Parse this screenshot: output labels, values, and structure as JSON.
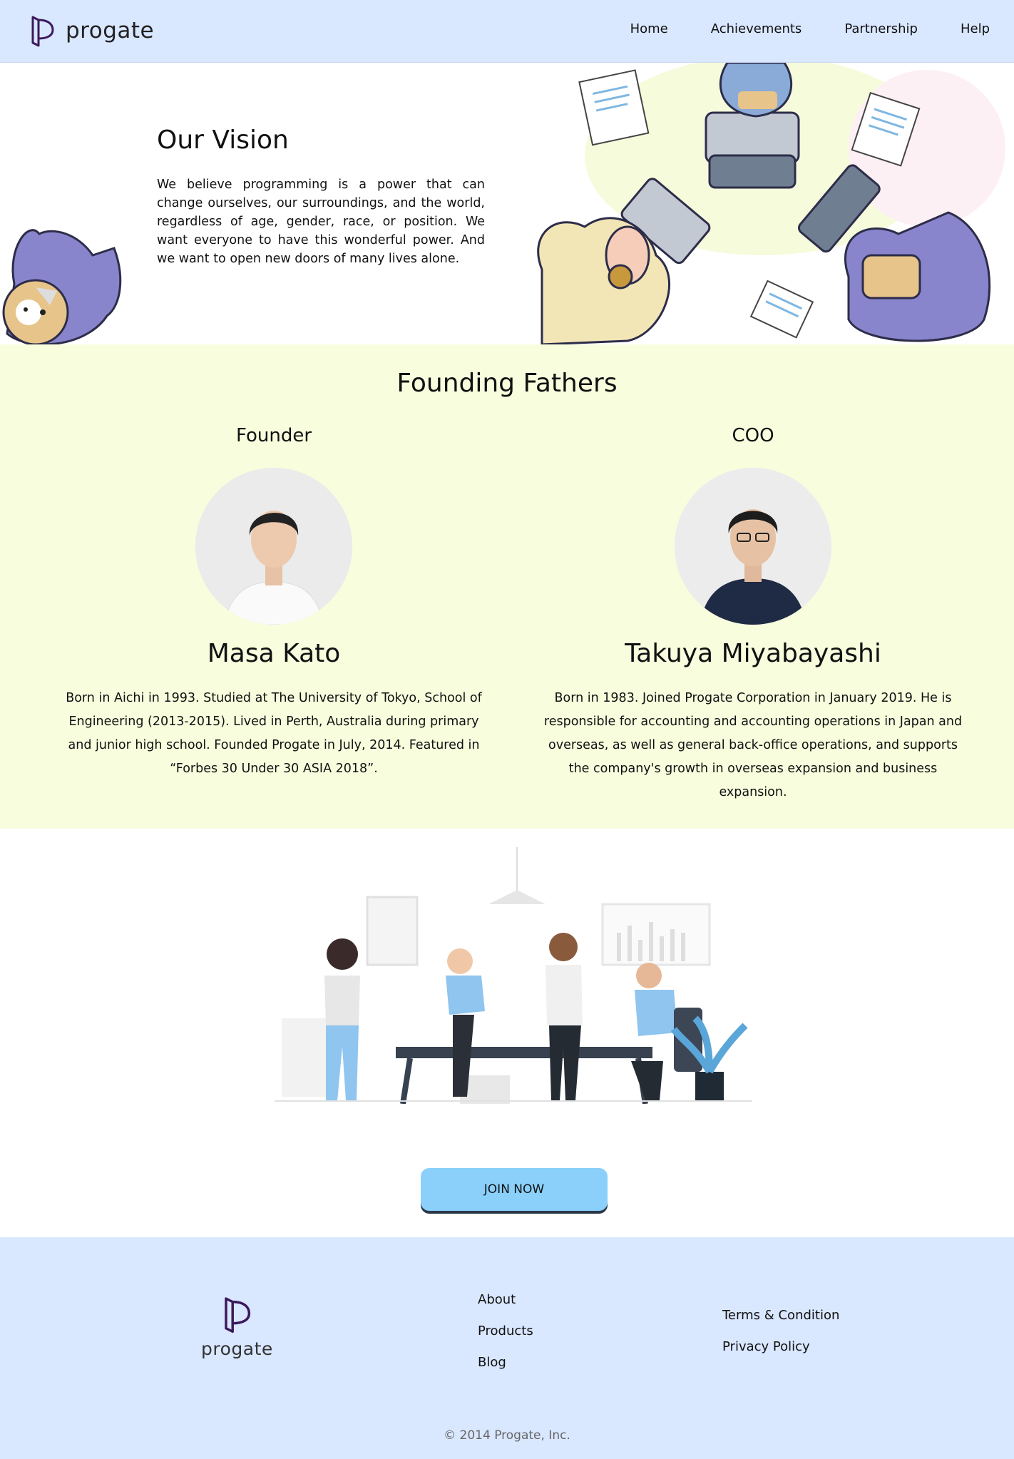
{
  "nav": {
    "brand": "progate",
    "links": [
      "Home",
      "Achievements",
      "Partnership",
      "Help"
    ]
  },
  "vision": {
    "title": "Our Vision",
    "text": "We believe programming is a power that can change ourselves, our surroundings, and the world, regardless of age, gender, race, or position. We want everyone to have this wonderful power. And we want to open new doors of many lives alone."
  },
  "founders": {
    "title": "Founding Fathers",
    "people": [
      {
        "role": "Founder",
        "name": "Masa Kato",
        "bio": "Born in Aichi in 1993. Studied at The University of Tokyo, School of Engineering (2013-2015). Lived in Perth, Australia during primary and junior high school. Founded Progate in July, 2014. Featured in “Forbes 30 Under 30 ASIA 2018”."
      },
      {
        "role": "COO",
        "name": "Takuya Miyabayashi",
        "bio": "Born in 1983. Joined Progate Corporation in January 2019. He is responsible for accounting and accounting operations in Japan and overseas, as well as general back-office operations, and supports the company's growth in overseas expansion and business expansion."
      }
    ]
  },
  "cta": {
    "join_label": "JOIN NOW"
  },
  "footer": {
    "brand": "progate",
    "links_col1": [
      "About",
      "Products",
      "Blog"
    ],
    "links_col2": [
      "Terms & Condition",
      "Privacy Policy"
    ],
    "copyright": "© 2014 Progate, Inc."
  },
  "colors": {
    "nav_bg": "#d9e7ff",
    "founders_bg": "#f7fddd",
    "button_bg": "#8ad0fb",
    "brand_purple": "#3b1a5c"
  }
}
